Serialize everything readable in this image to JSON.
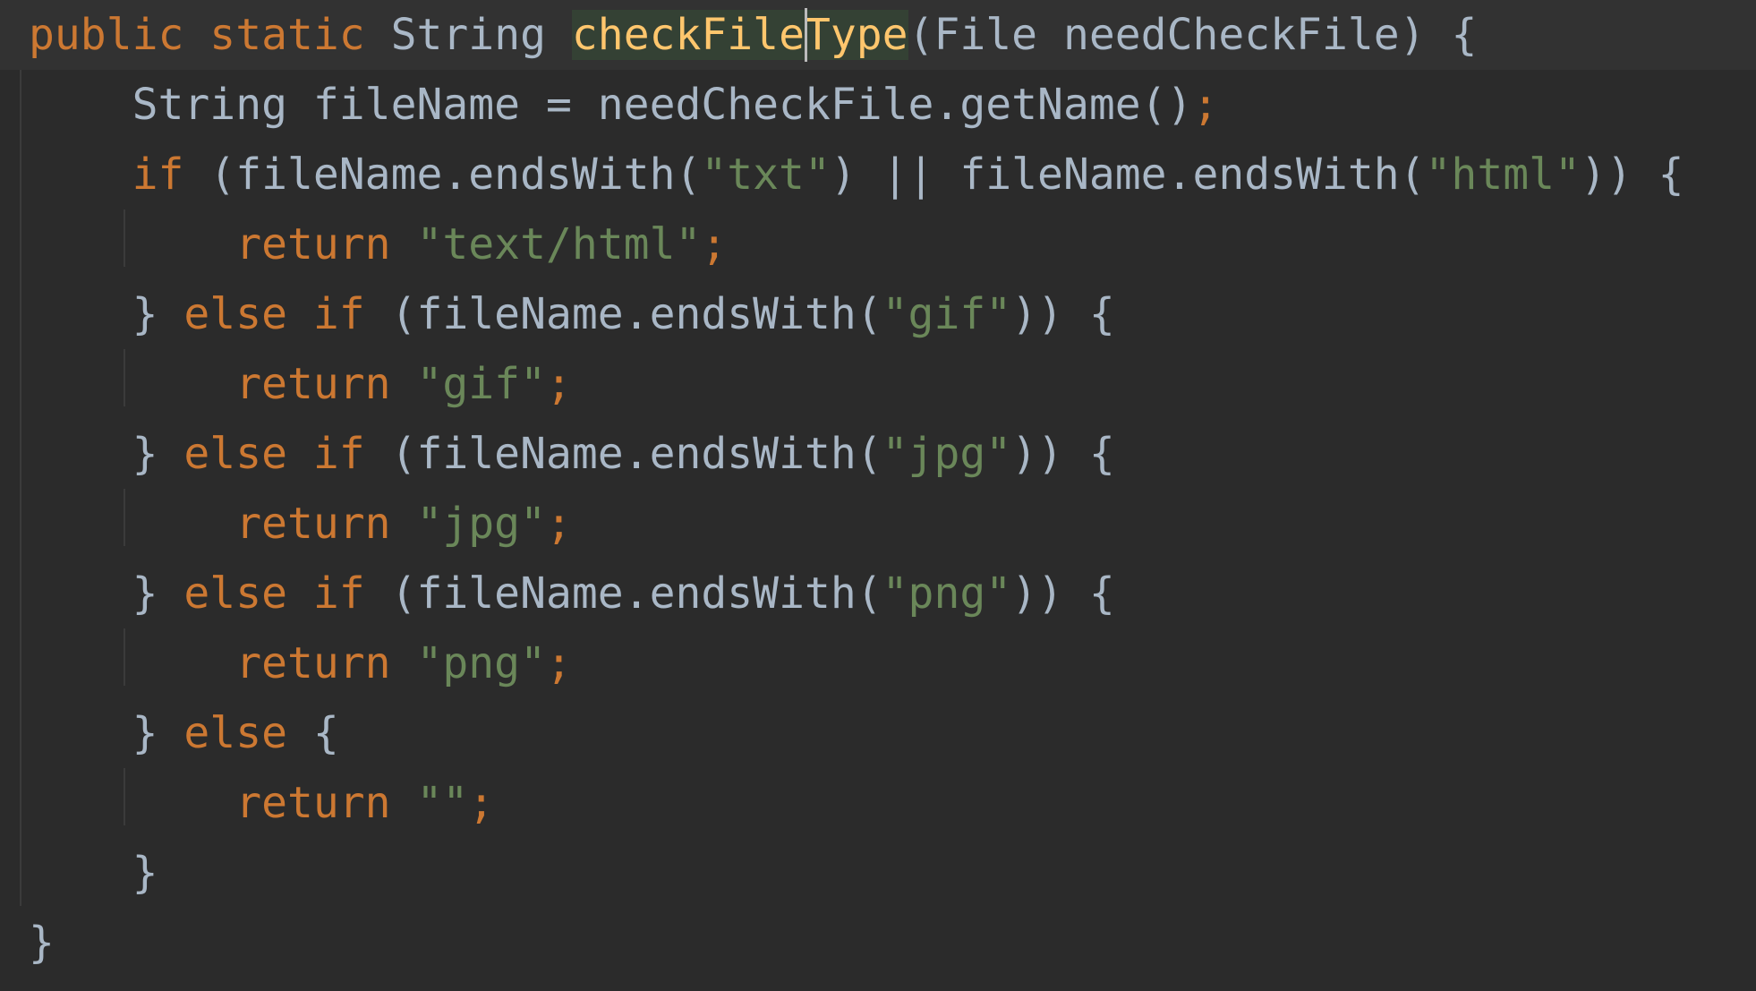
{
  "colors": {
    "background": "#2b2b2b",
    "current_line": "#323232",
    "keyword": "#cc7832",
    "string": "#6a8759",
    "function_name": "#ffc66d",
    "identifier": "#a9b7c6",
    "method_highlight": "#344134",
    "indent_guide": "#3b3b3b",
    "caret": "#bbbbbb"
  },
  "editor": {
    "current_line_index": 0,
    "caret": {
      "line": 1,
      "column": 31
    },
    "lines": [
      [
        {
          "t": "public",
          "k": "kw"
        },
        {
          "t": " ",
          "k": "punc"
        },
        {
          "t": "static",
          "k": "kw"
        },
        {
          "t": " ",
          "k": "punc"
        },
        {
          "t": "String",
          "k": "id"
        },
        {
          "t": " ",
          "k": "punc"
        },
        {
          "t": "checkFileType",
          "k": "fn",
          "highlight": true
        },
        {
          "t": "(File needCheckFile) {",
          "k": "punc"
        }
      ],
      [
        {
          "t": "    String fileName = needCheckFile.getName()",
          "k": "id"
        },
        {
          "t": ";",
          "k": "semi"
        }
      ],
      [
        {
          "t": "    ",
          "k": "punc"
        },
        {
          "t": "if",
          "k": "kw"
        },
        {
          "t": " (fileName.endsWith(",
          "k": "id"
        },
        {
          "t": "\"txt\"",
          "k": "str"
        },
        {
          "t": ") || fileName.endsWith(",
          "k": "id"
        },
        {
          "t": "\"html\"",
          "k": "str"
        },
        {
          "t": ")) {",
          "k": "punc"
        }
      ],
      [
        {
          "t": "        ",
          "k": "punc"
        },
        {
          "t": "return",
          "k": "kw"
        },
        {
          "t": " ",
          "k": "punc"
        },
        {
          "t": "\"text/html\"",
          "k": "str"
        },
        {
          "t": ";",
          "k": "semi"
        }
      ],
      [
        {
          "t": "    } ",
          "k": "punc"
        },
        {
          "t": "else if",
          "k": "kw"
        },
        {
          "t": " (fileName.endsWith(",
          "k": "id"
        },
        {
          "t": "\"gif\"",
          "k": "str"
        },
        {
          "t": ")) {",
          "k": "punc"
        }
      ],
      [
        {
          "t": "        ",
          "k": "punc"
        },
        {
          "t": "return",
          "k": "kw"
        },
        {
          "t": " ",
          "k": "punc"
        },
        {
          "t": "\"gif\"",
          "k": "str"
        },
        {
          "t": ";",
          "k": "semi"
        }
      ],
      [
        {
          "t": "    } ",
          "k": "punc"
        },
        {
          "t": "else if",
          "k": "kw"
        },
        {
          "t": " (fileName.endsWith(",
          "k": "id"
        },
        {
          "t": "\"jpg\"",
          "k": "str"
        },
        {
          "t": ")) {",
          "k": "punc"
        }
      ],
      [
        {
          "t": "        ",
          "k": "punc"
        },
        {
          "t": "return",
          "k": "kw"
        },
        {
          "t": " ",
          "k": "punc"
        },
        {
          "t": "\"jpg\"",
          "k": "str"
        },
        {
          "t": ";",
          "k": "semi"
        }
      ],
      [
        {
          "t": "    } ",
          "k": "punc"
        },
        {
          "t": "else if",
          "k": "kw"
        },
        {
          "t": " (fileName.endsWith(",
          "k": "id"
        },
        {
          "t": "\"png\"",
          "k": "str"
        },
        {
          "t": ")) {",
          "k": "punc"
        }
      ],
      [
        {
          "t": "        ",
          "k": "punc"
        },
        {
          "t": "return",
          "k": "kw"
        },
        {
          "t": " ",
          "k": "punc"
        },
        {
          "t": "\"png\"",
          "k": "str"
        },
        {
          "t": ";",
          "k": "semi"
        }
      ],
      [
        {
          "t": "    } ",
          "k": "punc"
        },
        {
          "t": "else",
          "k": "kw"
        },
        {
          "t": " {",
          "k": "punc"
        }
      ],
      [
        {
          "t": "        ",
          "k": "punc"
        },
        {
          "t": "return",
          "k": "kw"
        },
        {
          "t": " ",
          "k": "punc"
        },
        {
          "t": "\"\"",
          "k": "str"
        },
        {
          "t": ";",
          "k": "semi"
        }
      ],
      [
        {
          "t": "    }",
          "k": "punc"
        }
      ],
      [
        {
          "t": "}",
          "k": "punc"
        }
      ]
    ]
  }
}
